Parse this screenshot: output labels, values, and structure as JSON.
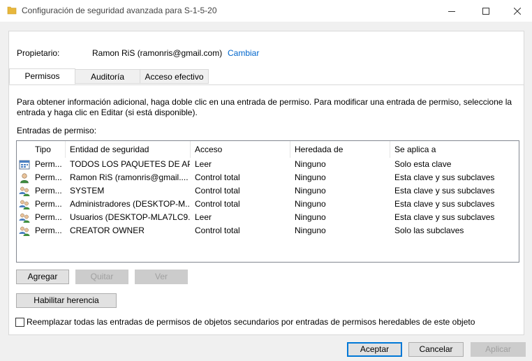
{
  "window": {
    "title": "Configuración de seguridad avanzada para S-1-5-20"
  },
  "owner": {
    "label": "Propietario:",
    "value": "Ramon RiS (ramonris@gmail.com)",
    "change_link": "Cambiar"
  },
  "tabs": [
    {
      "label": "Permisos",
      "active": true
    },
    {
      "label": "Auditoría",
      "active": false
    },
    {
      "label": "Acceso efectivo",
      "active": false
    }
  ],
  "info_text": "Para obtener información adicional, haga doble clic en una entrada de permiso. Para modificar una entrada de permiso, seleccione la entrada y haga clic en Editar (si está disponible).",
  "entries_label": "Entradas de permiso:",
  "columns": [
    "Tipo",
    "Entidad de seguridad",
    "Acceso",
    "Heredada de",
    "Se aplica a"
  ],
  "rows": [
    {
      "icon": "package-group-icon",
      "tipo": "Perm...",
      "entidad": "TODOS LOS PAQUETES DE AP...",
      "acceso": "Leer",
      "heredada": "Ninguno",
      "aplica": "Solo esta clave"
    },
    {
      "icon": "user-icon",
      "tipo": "Perm...",
      "entidad": "Ramon RiS (ramonris@gmail....",
      "acceso": "Control total",
      "heredada": "Ninguno",
      "aplica": "Esta clave y sus subclaves"
    },
    {
      "icon": "users-group-icon",
      "tipo": "Perm...",
      "entidad": "SYSTEM",
      "acceso": "Control total",
      "heredada": "Ninguno",
      "aplica": "Esta clave y sus subclaves"
    },
    {
      "icon": "users-group-icon",
      "tipo": "Perm...",
      "entidad": "Administradores (DESKTOP-M...",
      "acceso": "Control total",
      "heredada": "Ninguno",
      "aplica": "Esta clave y sus subclaves"
    },
    {
      "icon": "users-group-icon",
      "tipo": "Perm...",
      "entidad": "Usuarios (DESKTOP-MLA7LC9...",
      "acceso": "Leer",
      "heredada": "Ninguno",
      "aplica": "Esta clave y sus subclaves"
    },
    {
      "icon": "users-group-icon",
      "tipo": "Perm...",
      "entidad": "CREATOR OWNER",
      "acceso": "Control total",
      "heredada": "Ninguno",
      "aplica": "Solo las subclaves"
    }
  ],
  "buttons": {
    "add": "Agregar",
    "remove": "Quitar",
    "view": "Ver",
    "enable_inheritance": "Habilitar herencia",
    "ok": "Aceptar",
    "cancel": "Cancelar",
    "apply": "Aplicar"
  },
  "replace_checkbox": {
    "label": "Reemplazar todas las entradas de permisos de objetos secundarios por entradas de permisos heredables de este objeto",
    "checked": false
  },
  "colors": {
    "link": "#0066cc",
    "default_button_border": "#0078d7",
    "folder": "#e8b73c"
  }
}
